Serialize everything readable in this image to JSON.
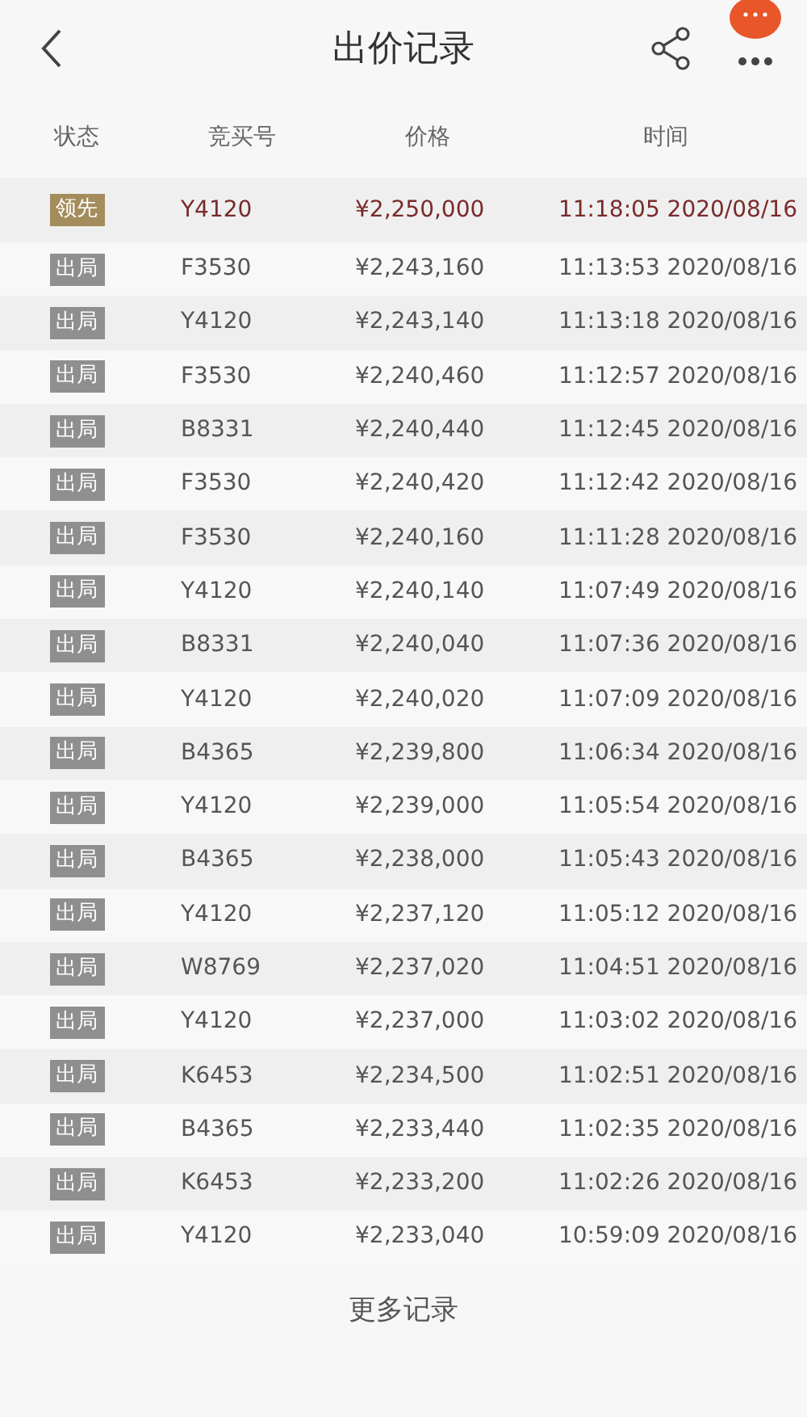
{
  "title": "出价记录",
  "columns": [
    "状态",
    "竞买号",
    "价格",
    "时间"
  ],
  "rows": [
    {
      "status": "领先",
      "kind": "leading",
      "bidder": "Y4120",
      "price": "¥2,250,000",
      "time": "11:18:05 2020/08/16"
    },
    {
      "status": "出局",
      "kind": "out",
      "bidder": "F3530",
      "price": "¥2,243,160",
      "time": "11:13:53 2020/08/16"
    },
    {
      "status": "出局",
      "kind": "out",
      "bidder": "Y4120",
      "price": "¥2,243,140",
      "time": "11:13:18 2020/08/16"
    },
    {
      "status": "出局",
      "kind": "out",
      "bidder": "F3530",
      "price": "¥2,240,460",
      "time": "11:12:57 2020/08/16"
    },
    {
      "status": "出局",
      "kind": "out",
      "bidder": "B8331",
      "price": "¥2,240,440",
      "time": "11:12:45 2020/08/16"
    },
    {
      "status": "出局",
      "kind": "out",
      "bidder": "F3530",
      "price": "¥2,240,420",
      "time": "11:12:42 2020/08/16"
    },
    {
      "status": "出局",
      "kind": "out",
      "bidder": "F3530",
      "price": "¥2,240,160",
      "time": "11:11:28 2020/08/16"
    },
    {
      "status": "出局",
      "kind": "out",
      "bidder": "Y4120",
      "price": "¥2,240,140",
      "time": "11:07:49 2020/08/16"
    },
    {
      "status": "出局",
      "kind": "out",
      "bidder": "B8331",
      "price": "¥2,240,040",
      "time": "11:07:36 2020/08/16"
    },
    {
      "status": "出局",
      "kind": "out",
      "bidder": "Y4120",
      "price": "¥2,240,020",
      "time": "11:07:09 2020/08/16"
    },
    {
      "status": "出局",
      "kind": "out",
      "bidder": "B4365",
      "price": "¥2,239,800",
      "time": "11:06:34 2020/08/16"
    },
    {
      "status": "出局",
      "kind": "out",
      "bidder": "Y4120",
      "price": "¥2,239,000",
      "time": "11:05:54 2020/08/16"
    },
    {
      "status": "出局",
      "kind": "out",
      "bidder": "B4365",
      "price": "¥2,238,000",
      "time": "11:05:43 2020/08/16"
    },
    {
      "status": "出局",
      "kind": "out",
      "bidder": "Y4120",
      "price": "¥2,237,120",
      "time": "11:05:12 2020/08/16"
    },
    {
      "status": "出局",
      "kind": "out",
      "bidder": "W8769",
      "price": "¥2,237,020",
      "time": "11:04:51 2020/08/16"
    },
    {
      "status": "出局",
      "kind": "out",
      "bidder": "Y4120",
      "price": "¥2,237,000",
      "time": "11:03:02 2020/08/16"
    },
    {
      "status": "出局",
      "kind": "out",
      "bidder": "K6453",
      "price": "¥2,234,500",
      "time": "11:02:51 2020/08/16"
    },
    {
      "status": "出局",
      "kind": "out",
      "bidder": "B4365",
      "price": "¥2,233,440",
      "time": "11:02:35 2020/08/16"
    },
    {
      "status": "出局",
      "kind": "out",
      "bidder": "K6453",
      "price": "¥2,233,200",
      "time": "11:02:26 2020/08/16"
    },
    {
      "status": "出局",
      "kind": "out",
      "bidder": "Y4120",
      "price": "¥2,233,040",
      "time": "10:59:09 2020/08/16"
    }
  ],
  "more_link": "更多记录"
}
